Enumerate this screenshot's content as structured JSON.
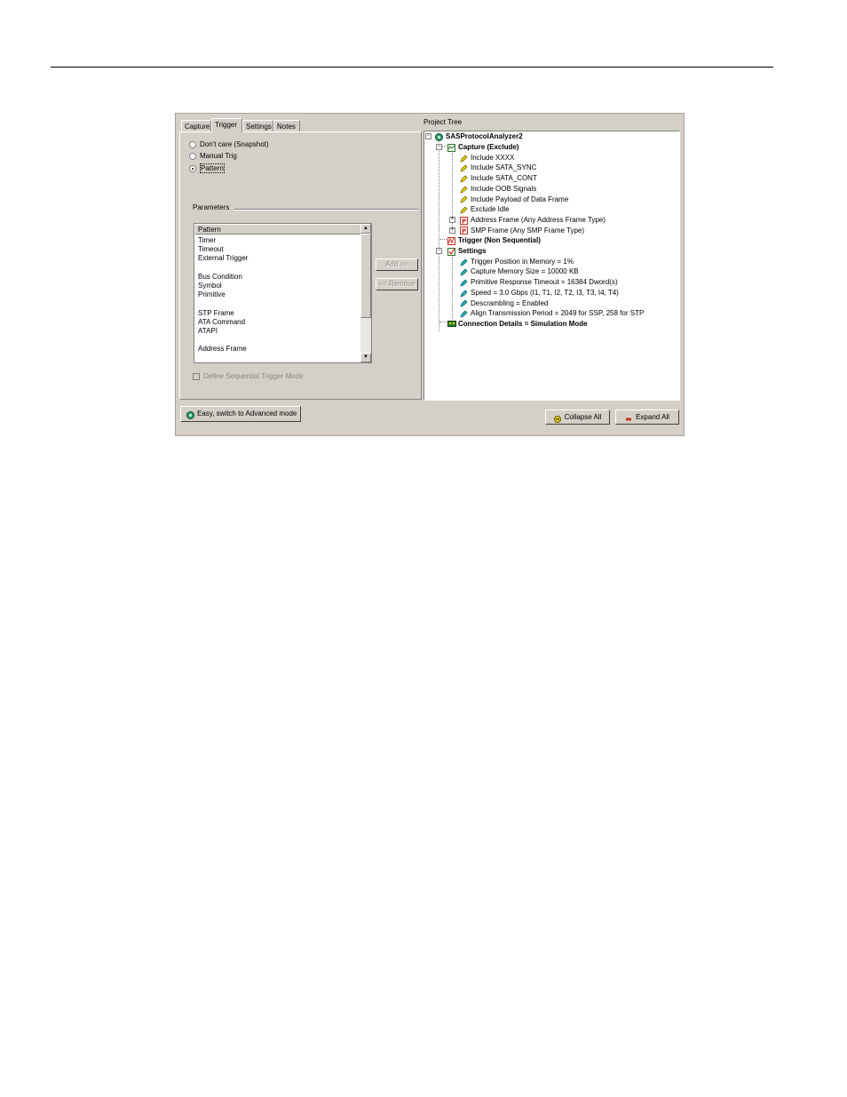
{
  "tabs": [
    {
      "label": "Capture"
    },
    {
      "label": "Trigger"
    },
    {
      "label": "Settings"
    },
    {
      "label": "Notes"
    }
  ],
  "trigger": {
    "options": [
      {
        "label": "Don't care (Snapshot)",
        "selected": false
      },
      {
        "label": "Manual Trig",
        "selected": false
      },
      {
        "label": "Pattern",
        "selected": true
      }
    ],
    "parameters_title": "Parameters",
    "list_header": "Pattern",
    "list_items": [
      "Timer",
      "Timeout",
      "External Trigger",
      "",
      "Bus Condition",
      "Symbol",
      "Primitive",
      "",
      "STP Frame",
      "ATA Command",
      "ATAPI",
      "",
      "Address Frame"
    ],
    "add_label": "Add >>",
    "remove_label": "<< Remove",
    "sequential_label": "Define Sequential Trigger Mode"
  },
  "project_tree": {
    "title": "Project Tree",
    "root": "SASProtocolAnalyzer2",
    "capture": "Capture (Exclude)",
    "capture_items": [
      "Include XXXX",
      "Include SATA_SYNC",
      "Include SATA_CONT",
      "Include OOB Signals",
      "Include Payload of Data Frame",
      "Exclude Idle"
    ],
    "capture_frames": [
      "Address Frame (Any Address Frame Type)",
      "SMP Frame (Any SMP Frame Type)"
    ],
    "trigger": "Trigger (Non Sequential)",
    "settings": "Settings",
    "settings_items": [
      "Trigger Position in Memory = 1%",
      "Capture Memory Size = 10000 KB",
      "Primitive Response Timeout = 16384 Dword(s)",
      "Speed = 3.0 Gbps (I1, T1, I2, T2, I3, T3, I4, T4)",
      "Descrambling = Enabled",
      "Align Transmission Period = 2049 for SSP, 258 for STP"
    ],
    "connection": "Connection Details = Simulation Mode"
  },
  "footer": {
    "switch_label": "Easy, switch to Advanced mode",
    "collapse_label": "Collapse All",
    "expand_label": "Expand All"
  },
  "colors": {
    "dialog_bg": "#d4d0c8",
    "pencil_yellow": "#e8d200",
    "pencil_teal": "#22b0b8",
    "frame_red": "#c83020"
  }
}
